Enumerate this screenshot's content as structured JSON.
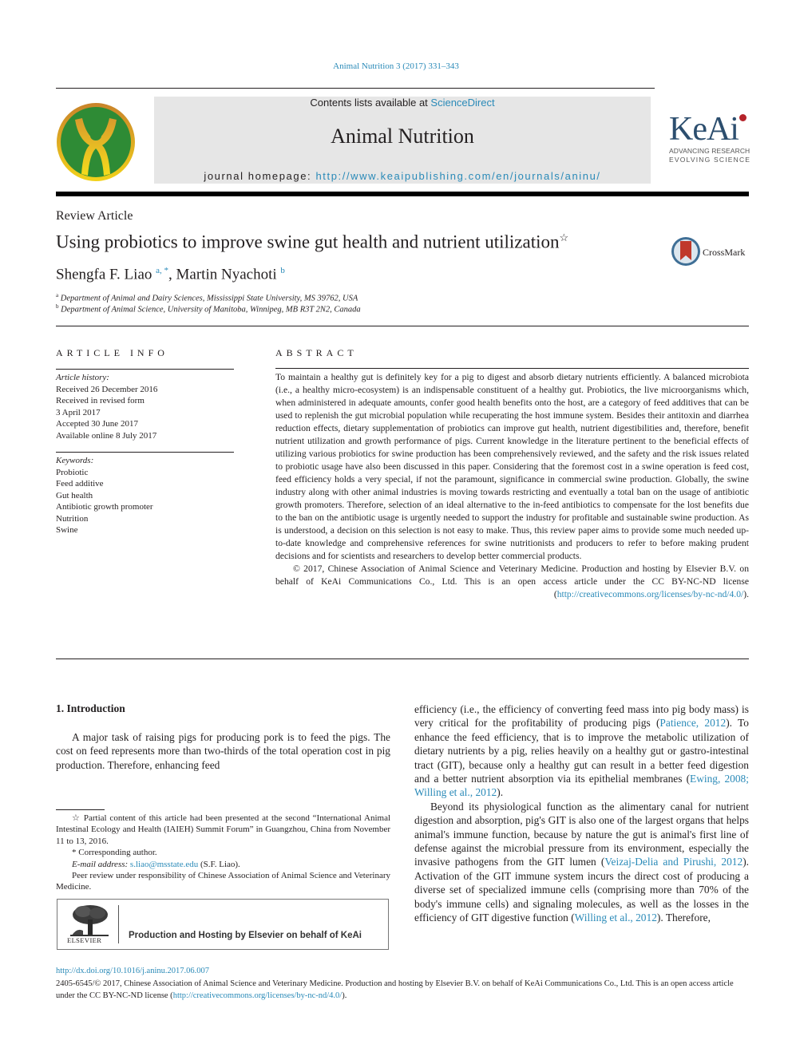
{
  "running_head": "Animal Nutrition 3 (2017) 331–343",
  "header": {
    "contents_prefix": "Contents lists available at ",
    "contents_link": "ScienceDirect",
    "journal_title": "Animal Nutrition",
    "homepage_prefix": "journal homepage: ",
    "homepage_link": "http://www.keaipublishing.com/en/journals/aninu/",
    "journal_logo_icon": "journal-emblem-icon",
    "publisher_logo": {
      "word": "KeAi",
      "tagline_1": "ADVANCING RESEARCH",
      "tagline_2": "EVOLVING SCIENCE"
    }
  },
  "article": {
    "type": "Review Article",
    "title": "Using probiotics to improve swine gut health and nutrient utilization",
    "title_mark": "☆",
    "crossmark_label": "CrossMark",
    "authors": [
      {
        "name": "Shengfa F. Liao",
        "marks": "a, *"
      },
      {
        "name": "Martin Nyachoti",
        "marks": "b"
      }
    ],
    "affiliations": [
      {
        "mark": "a",
        "text": "Department of Animal and Dairy Sciences, Mississippi State University, MS 39762, USA"
      },
      {
        "mark": "b",
        "text": "Department of Animal Science, University of Manitoba, Winnipeg, MB R3T 2N2, Canada"
      }
    ]
  },
  "article_info": {
    "heading": "ARTICLE INFO",
    "history_label": "Article history:",
    "history": [
      "Received 26 December 2016",
      "Received in revised form",
      "3 April 2017",
      "Accepted 30 June 2017",
      "Available online 8 July 2017"
    ],
    "keywords_label": "Keywords:",
    "keywords": [
      "Probiotic",
      "Feed additive",
      "Gut health",
      "Antibiotic growth promoter",
      "Nutrition",
      "Swine"
    ]
  },
  "abstract": {
    "heading": "ABSTRACT",
    "body": "To maintain a healthy gut is definitely key for a pig to digest and absorb dietary nutrients efficiently. A balanced microbiota (i.e., a healthy micro-ecosystem) is an indispensable constituent of a healthy gut. Probiotics, the live microorganisms which, when administered in adequate amounts, confer good health benefits onto the host, are a category of feed additives that can be used to replenish the gut microbial population while recuperating the host immune system. Besides their antitoxin and diarrhea reduction effects, dietary supplementation of probiotics can improve gut health, nutrient digestibilities and, therefore, benefit nutrient utilization and growth performance of pigs. Current knowledge in the literature pertinent to the beneficial effects of utilizing various probiotics for swine production has been comprehensively reviewed, and the safety and the risk issues related to probiotic usage have also been discussed in this paper. Considering that the foremost cost in a swine operation is feed cost, feed efficiency holds a very special, if not the paramount, significance in commercial swine production. Globally, the swine industry along with other animal industries is moving towards restricting and eventually a total ban on the usage of antibiotic growth promoters. Therefore, selection of an ideal alternative to the in-feed antibiotics to compensate for the lost benefits due to the ban on the antibiotic usage is urgently needed to support the industry for profitable and sustainable swine production. As is understood, a decision on this selection is not easy to make. Thus, this review paper aims to provide some much needed up-to-date knowledge and comprehensive references for swine nutritionists and producers to refer to before making prudent decisions and for scientists and researchers to develop better commercial products.",
    "copyright_text": "© 2017, Chinese Association of Animal Science and Veterinary Medicine. Production and hosting by Elsevier B.V. on behalf of KeAi Communications Co., Ltd. This is an open access article under the CC BY-NC-ND license (",
    "license_link": "http://creativecommons.org/licenses/by-nc-nd/4.0/",
    "copyright_close": ")."
  },
  "introduction": {
    "heading": "1.  Introduction",
    "left_paragraph": "A major task of raising pigs for producing pork is to feed the pigs. The cost on feed represents more than two-thirds of the total operation cost in pig production. Therefore, enhancing feed",
    "right_p1": {
      "t1": "efficiency (i.e., the efficiency of converting feed mass into pig body mass) is very critical for the profitability of producing pigs (",
      "c1": "Patience, 2012",
      "t2": "). To enhance the feed efficiency, that is to improve the metabolic utilization of dietary nutrients by a pig, relies heavily on a healthy gut or gastro-intestinal tract (GIT), because only a healthy gut can result in a better feed digestion and a better nutrient absorption via its epithelial membranes (",
      "c2": "Ewing, 2008; Willing et al., 2012",
      "t3": ")."
    },
    "right_p2": {
      "t1": "Beyond its physiological function as the alimentary canal for nutrient digestion and absorption, pig's GIT is also one of the largest organs that helps animal's immune function, because by nature the gut is animal's first line of defense against the microbial pressure from its environment, especially the invasive pathogens from the GIT lumen (",
      "c1": "Veizaj-Delia and Pirushi, 2012",
      "t2": "). Activation of the GIT immune system incurs the direct cost of producing a diverse set of specialized immune cells (comprising more than 70% of the body's immune cells) and signaling molecules, as well as the losses in the efficiency of GIT digestive function (",
      "c2": "Willing et al., 2012",
      "t3": "). Therefore,"
    }
  },
  "footnotes": {
    "star_mark": "☆",
    "star_text": "Partial content of this article had been presented at the second “International Animal Intestinal Ecology and Health (IAIEH) Summit Forum” in Guangzhou, China from November 11 to 13, 2016.",
    "corr_mark": "*",
    "corr_text": "Corresponding author.",
    "email_label": "E-mail address: ",
    "email": "s.liao@msstate.edu",
    "email_suffix": " (S.F. Liao).",
    "peer_review": "Peer review under responsibility of Chinese Association of Animal Science and Veterinary Medicine."
  },
  "elsevier_box": {
    "logo_word": "ELSEVIER",
    "caption": "Production and Hosting by Elsevier on behalf of KeAi"
  },
  "bottom": {
    "doi": "http://dx.doi.org/10.1016/j.aninu.2017.06.007",
    "copyright": "2405-6545/© 2017, Chinese Association of Animal Science and Veterinary Medicine. Production and hosting by Elsevier B.V. on behalf of KeAi Communications Co., Ltd. This is an open access article under the CC BY-NC-ND license (",
    "license_link": "http://creativecommons.org/licenses/by-nc-nd/4.0/",
    "copyright_close": ")."
  },
  "colors": {
    "link": "#2a8ab8",
    "header_band": "#e6e6e6",
    "keai_blue": "#2c4e6e",
    "keai_red": "#b5232a",
    "emblem_green": "#2e8b35",
    "emblem_gold": "#e3b21d"
  }
}
